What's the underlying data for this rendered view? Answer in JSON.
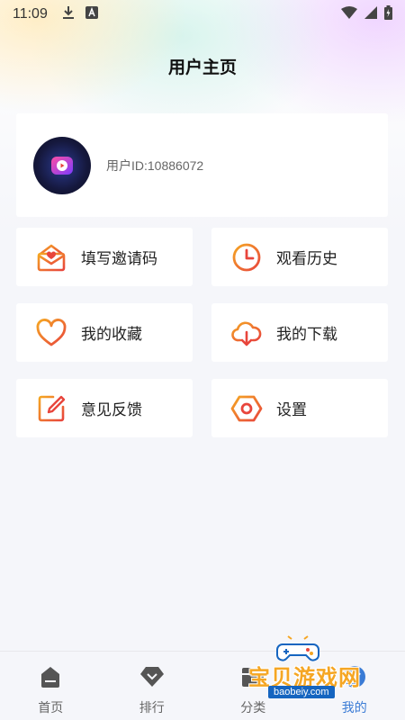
{
  "status_bar": {
    "time": "11:09"
  },
  "header": {
    "title": "用户主页"
  },
  "profile": {
    "user_id": "用户ID:10886072"
  },
  "menu": [
    {
      "label": "填写邀请码",
      "icon": "invitation-envelope-icon"
    },
    {
      "label": "观看历史",
      "icon": "clock-icon"
    },
    {
      "label": "我的收藏",
      "icon": "heart-icon"
    },
    {
      "label": "我的下载",
      "icon": "cloud-download-icon"
    },
    {
      "label": "意见反馈",
      "icon": "edit-feedback-icon"
    },
    {
      "label": "设置",
      "icon": "settings-hexagon-icon"
    }
  ],
  "tabs": [
    {
      "label": "首页",
      "icon": "home-icon"
    },
    {
      "label": "排行",
      "icon": "ranking-icon"
    },
    {
      "label": "分类",
      "icon": "category-icon"
    },
    {
      "label": "我的",
      "icon": "profile-icon",
      "active": true
    }
  ],
  "watermark": {
    "text": "宝贝游戏网",
    "url": "baobeiy.com"
  },
  "colors": {
    "accent_start": "#f5a623",
    "accent_end": "#e8453c",
    "active_tab": "#3a7bd5"
  }
}
